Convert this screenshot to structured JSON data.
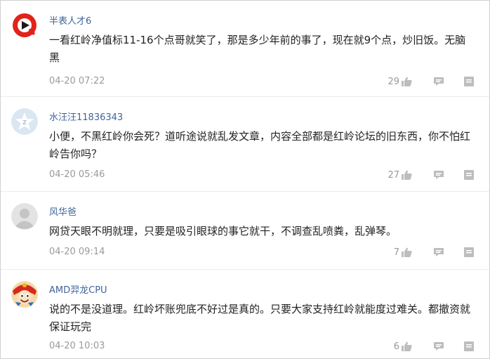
{
  "comments": [
    {
      "username": "半表人才6",
      "text": "一看红岭净值标11-16个点哥就笑了，那是多少年前的事了，现在就9个点，炒旧饭。无脑黑",
      "time": "04-20 07:22",
      "likes": "29",
      "avatar_icon": "red-circle-play-logo-avatar"
    },
    {
      "username": "水汪汪11836343",
      "text": "小便，不黑红岭你会死？道听途说就乱发文章，内容全部都是红岭论坛的旧东西，你不怕红岭告你吗？",
      "time": "04-20 05:46",
      "likes": "27",
      "avatar_icon": "blue-star-avatar"
    },
    {
      "username": "风华爸",
      "text": "网贷天眼不明就理，只要是吸引眼球的事它就干，不调查乱喷粪，乱弹琴。",
      "time": "04-20 09:14",
      "likes": "7",
      "avatar_icon": "default-person-avatar"
    },
    {
      "username": "AMD羿龙CPU",
      "text": "说的不是没道理。红岭坏账兜底不好过是真的。只要大家支持红岭就能度过难关。都撤资就保证玩完",
      "time": "04-20 10:03",
      "likes": "6",
      "avatar_icon": "cartoon-character-avatar"
    }
  ],
  "colors": {
    "username": "#406599",
    "meta": "#9a9a9a",
    "icon": "#bdbdbd"
  }
}
